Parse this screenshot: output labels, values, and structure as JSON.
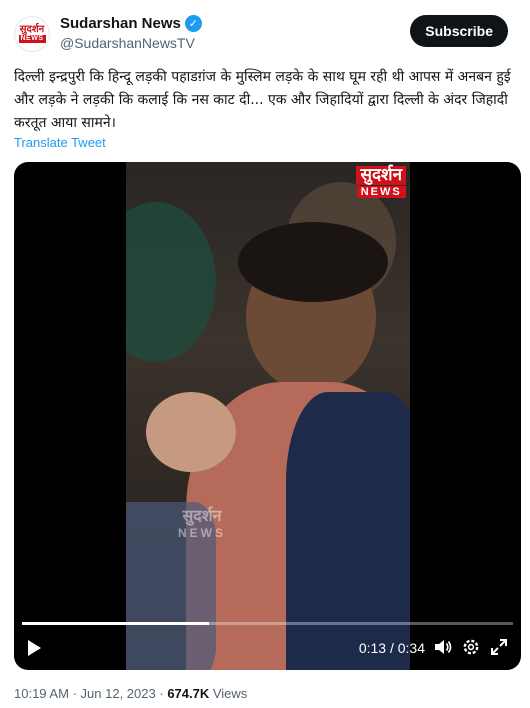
{
  "account": {
    "display_name": "Sudarshan News",
    "handle": "@SudarshanNewsTV",
    "avatar_text_top": "सुदर्शन",
    "avatar_text_bottom": "NEWS",
    "verified": true
  },
  "subscribe_label": "Subscribe",
  "tweet": {
    "text": "दिल्ली इन्द्रपुरी कि हिन्दू लड़की पहाडग़ंज के मुस्लिम लड़के के साथ घूम रही थी आपस में अनबन हुई और लड़के ने लड़की कि कलाई कि नस काट दी... एक और जिहादियों द्वारा दिल्ली के अंदर जिहादी करतूत आया सामने।",
    "translate_label": "Translate Tweet"
  },
  "video": {
    "logo_top": "सुदर्शन",
    "logo_bottom": "NEWS",
    "watermark_top": "सुदर्शन",
    "watermark_bottom": "NEWS",
    "current_time": "0:13",
    "duration": "0:34",
    "timecode": "0:13 / 0:34",
    "progress": 0.38
  },
  "meta": {
    "time": "10:19 AM",
    "separator": "·",
    "date": "Jun 12, 2023",
    "views_count": "674.7K",
    "views_label": "Views"
  },
  "colors": {
    "accent": "#1d9bf0",
    "brand_red": "#d0121b",
    "text": "#0f1419",
    "muted": "#536471"
  },
  "icons": [
    "verified-badge-icon",
    "play-icon",
    "volume-icon",
    "settings-icon",
    "fullscreen-icon"
  ]
}
